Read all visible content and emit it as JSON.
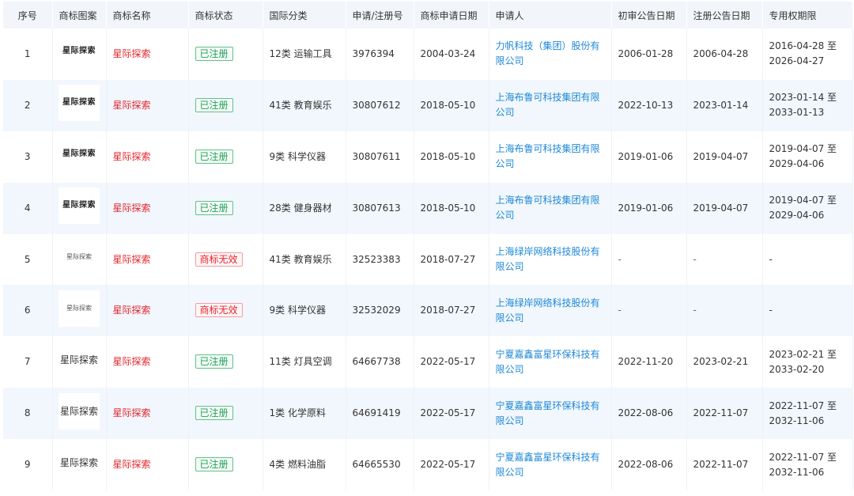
{
  "columns": [
    "序号",
    "商标图案",
    "商标名称",
    "商标状态",
    "国际分类",
    "申请/注册号",
    "商标申请日期",
    "申请人",
    "初审公告日期",
    "注册公告日期",
    "专用权期限"
  ],
  "colors": {
    "header_bg": "#f2f6fb",
    "row_alt_bg": "#f1f7fd",
    "name_red": "#e5262e",
    "applicant_blue": "#1e88d6",
    "status_ok_green": "#22a05a",
    "status_bad_red": "#e5262e"
  },
  "rows": [
    {
      "no": "1",
      "logo_text": "星际探索",
      "logo_style": "bold",
      "name": "星际探索",
      "status": "已注册",
      "status_type": "ok",
      "class": "12类 运输工具",
      "reg_no": "3976394",
      "apply_date": "2004-03-24",
      "applicant": "力帆科技（集团）股份有限公司",
      "prelim_date": "2006-01-28",
      "reg_date": "2006-04-28",
      "term_start": "2016-04-28 至",
      "term_end": "2026-04-27"
    },
    {
      "no": "2",
      "logo_text": "星际探索",
      "logo_style": "bold",
      "name": "星际探索",
      "status": "已注册",
      "status_type": "ok",
      "class": "41类 教育娱乐",
      "reg_no": "30807612",
      "apply_date": "2018-05-10",
      "applicant": "上海布鲁可科技集团有限公司",
      "prelim_date": "2022-10-13",
      "reg_date": "2023-01-14",
      "term_start": "2023-01-14 至",
      "term_end": "2033-01-13"
    },
    {
      "no": "3",
      "logo_text": "星际探索",
      "logo_style": "bold",
      "name": "星际探索",
      "status": "已注册",
      "status_type": "ok",
      "class": "9类 科学仪器",
      "reg_no": "30807611",
      "apply_date": "2018-05-10",
      "applicant": "上海布鲁可科技集团有限公司",
      "prelim_date": "2019-01-06",
      "reg_date": "2019-04-07",
      "term_start": "2019-04-07 至",
      "term_end": "2029-04-06"
    },
    {
      "no": "4",
      "logo_text": "星际探索",
      "logo_style": "bold",
      "name": "星际探索",
      "status": "已注册",
      "status_type": "ok",
      "class": "28类 健身器材",
      "reg_no": "30807613",
      "apply_date": "2018-05-10",
      "applicant": "上海布鲁可科技集团有限公司",
      "prelim_date": "2019-01-06",
      "reg_date": "2019-04-07",
      "term_start": "2019-04-07 至",
      "term_end": "2029-04-06"
    },
    {
      "no": "5",
      "logo_text": "星际探索",
      "logo_style": "light",
      "name": "星际探索",
      "status": "商标无效",
      "status_type": "bad",
      "class": "41类 教育娱乐",
      "reg_no": "32523383",
      "apply_date": "2018-07-27",
      "applicant": "上海绿岸网络科技股份有限公司",
      "prelim_date": "-",
      "reg_date": "-",
      "term_start": "-",
      "term_end": ""
    },
    {
      "no": "6",
      "logo_text": "星际探索",
      "logo_style": "light",
      "name": "星际探索",
      "status": "商标无效",
      "status_type": "bad",
      "class": "9类 科学仪器",
      "reg_no": "32532029",
      "apply_date": "2018-07-27",
      "applicant": "上海绿岸网络科技股份有限公司",
      "prelim_date": "-",
      "reg_date": "-",
      "term_start": "-",
      "term_end": ""
    },
    {
      "no": "7",
      "logo_text": "星际探索",
      "logo_style": "plain",
      "name": "星际探索",
      "status": "已注册",
      "status_type": "ok",
      "class": "11类 灯具空调",
      "reg_no": "64667738",
      "apply_date": "2022-05-17",
      "applicant": "宁夏嘉鑫富星环保科技有限公司",
      "prelim_date": "2022-11-20",
      "reg_date": "2023-02-21",
      "term_start": "2023-02-21 至",
      "term_end": "2033-02-20"
    },
    {
      "no": "8",
      "logo_text": "星际探索",
      "logo_style": "plain",
      "name": "星际探索",
      "status": "已注册",
      "status_type": "ok",
      "class": "1类 化学原料",
      "reg_no": "64691419",
      "apply_date": "2022-05-17",
      "applicant": "宁夏嘉鑫富星环保科技有限公司",
      "prelim_date": "2022-08-06",
      "reg_date": "2022-11-07",
      "term_start": "2022-11-07 至",
      "term_end": "2032-11-06"
    },
    {
      "no": "9",
      "logo_text": "星际探索",
      "logo_style": "plain",
      "name": "星际探索",
      "status": "已注册",
      "status_type": "ok",
      "class": "4类 燃料油脂",
      "reg_no": "64665530",
      "apply_date": "2022-05-17",
      "applicant": "宁夏嘉鑫富星环保科技有限公司",
      "prelim_date": "2022-08-06",
      "reg_date": "2022-11-07",
      "term_start": "2022-11-07 至",
      "term_end": "2032-11-06"
    }
  ]
}
